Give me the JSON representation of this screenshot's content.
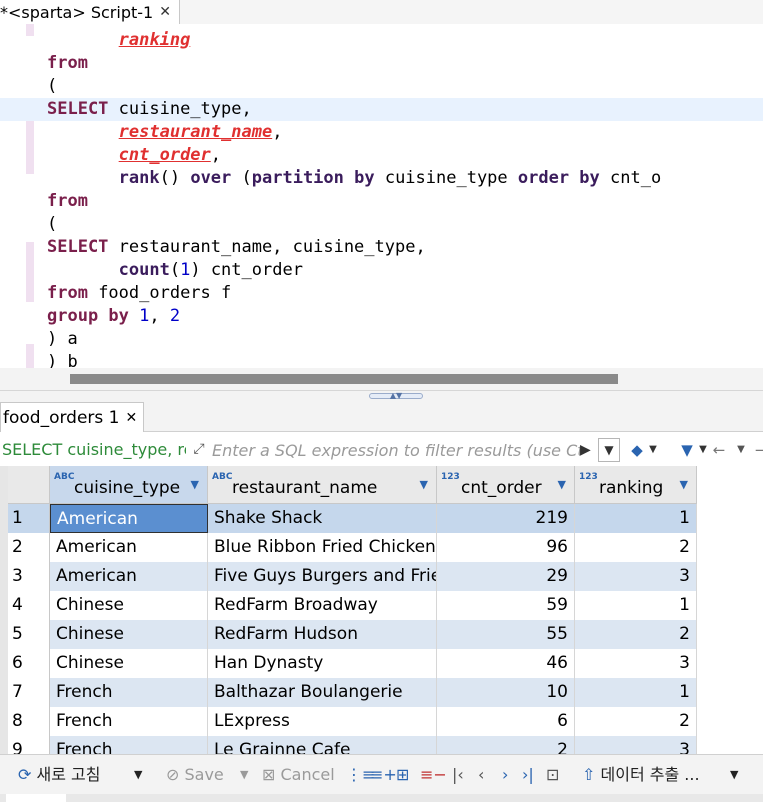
{
  "editor_tab": {
    "title": "*<sparta> Script-1",
    "close": "✕"
  },
  "code_lines": [
    {
      "parts": [
        {
          "t": "       ",
          "c": "plain"
        },
        {
          "t": "ranking",
          "c": "err"
        }
      ]
    },
    {
      "parts": [
        {
          "t": "from",
          "c": "kw"
        }
      ]
    },
    {
      "parts": [
        {
          "t": "(",
          "c": "plain"
        }
      ]
    },
    {
      "parts": [
        {
          "t": "SELECT",
          "c": "kw"
        },
        {
          "t": " cuisine_type,",
          "c": "plain"
        }
      ],
      "current": true
    },
    {
      "parts": [
        {
          "t": "       ",
          "c": "plain"
        },
        {
          "t": "restaurant_name",
          "c": "err"
        },
        {
          "t": ",",
          "c": "plain"
        }
      ]
    },
    {
      "parts": [
        {
          "t": "       ",
          "c": "plain"
        },
        {
          "t": "cnt_order",
          "c": "err"
        },
        {
          "t": ",",
          "c": "plain"
        }
      ]
    },
    {
      "parts": [
        {
          "t": "       ",
          "c": "plain"
        },
        {
          "t": "rank",
          "c": "kw2"
        },
        {
          "t": "() ",
          "c": "plain"
        },
        {
          "t": "over",
          "c": "kw2"
        },
        {
          "t": " (",
          "c": "plain"
        },
        {
          "t": "partition by",
          "c": "kw2"
        },
        {
          "t": " cuisine_type ",
          "c": "plain"
        },
        {
          "t": "order by",
          "c": "kw2"
        },
        {
          "t": " cnt_o",
          "c": "plain"
        }
      ]
    },
    {
      "parts": [
        {
          "t": "from",
          "c": "kw"
        }
      ]
    },
    {
      "parts": [
        {
          "t": "(",
          "c": "plain"
        }
      ]
    },
    {
      "parts": [
        {
          "t": "SELECT",
          "c": "kw"
        },
        {
          "t": " restaurant_name, cuisine_type,",
          "c": "plain"
        }
      ]
    },
    {
      "parts": [
        {
          "t": "       ",
          "c": "plain"
        },
        {
          "t": "count",
          "c": "kw2"
        },
        {
          "t": "(",
          "c": "plain"
        },
        {
          "t": "1",
          "c": "num"
        },
        {
          "t": ") cnt_order",
          "c": "plain"
        }
      ]
    },
    {
      "parts": [
        {
          "t": "from",
          "c": "kw"
        },
        {
          "t": " food_orders f",
          "c": "plain"
        }
      ]
    },
    {
      "parts": [
        {
          "t": "group by",
          "c": "kw"
        },
        {
          "t": " ",
          "c": "plain"
        },
        {
          "t": "1",
          "c": "num"
        },
        {
          "t": ", ",
          "c": "plain"
        },
        {
          "t": "2",
          "c": "num"
        }
      ]
    },
    {
      "parts": [
        {
          "t": ") a",
          "c": "plain"
        }
      ]
    },
    {
      "parts": [
        {
          "t": ") b",
          "c": "plain"
        }
      ]
    }
  ],
  "results_tab": {
    "title": "food_orders 1",
    "close": "✕"
  },
  "filter": {
    "sql_preview": "SELECT cuisine_type, re",
    "placeholder": "Enter a SQL expression to filter results (use Ctrl+Space)"
  },
  "columns": [
    {
      "type": "ABC",
      "label": "cuisine_type"
    },
    {
      "type": "ABC",
      "label": "restaurant_name"
    },
    {
      "type": "123",
      "label": "cnt_order"
    },
    {
      "type": "123",
      "label": "ranking"
    }
  ],
  "rows": [
    {
      "n": "1",
      "cuisine_type": "American",
      "restaurant_name": "Shake Shack",
      "cnt_order": "219",
      "ranking": "1"
    },
    {
      "n": "2",
      "cuisine_type": "American",
      "restaurant_name": "Blue Ribbon Fried Chicken",
      "cnt_order": "96",
      "ranking": "2"
    },
    {
      "n": "3",
      "cuisine_type": "American",
      "restaurant_name": "Five Guys Burgers and Fries",
      "cnt_order": "29",
      "ranking": "3"
    },
    {
      "n": "4",
      "cuisine_type": "Chinese",
      "restaurant_name": "RedFarm Broadway",
      "cnt_order": "59",
      "ranking": "1"
    },
    {
      "n": "5",
      "cuisine_type": "Chinese",
      "restaurant_name": "RedFarm Hudson",
      "cnt_order": "55",
      "ranking": "2"
    },
    {
      "n": "6",
      "cuisine_type": "Chinese",
      "restaurant_name": "Han Dynasty",
      "cnt_order": "46",
      "ranking": "3"
    },
    {
      "n": "7",
      "cuisine_type": "French",
      "restaurant_name": "Balthazar Boulangerie",
      "cnt_order": "10",
      "ranking": "1"
    },
    {
      "n": "8",
      "cuisine_type": "French",
      "restaurant_name": "LExpress",
      "cnt_order": "6",
      "ranking": "2"
    },
    {
      "n": "9",
      "cuisine_type": "French",
      "restaurant_name": "Le Grainne Cafe",
      "cnt_order": "2",
      "ranking": "3"
    }
  ],
  "toolbar": {
    "refresh": "새로 고침",
    "save": "Save",
    "cancel": "Cancel",
    "export": "데이터 추출 ..."
  },
  "colors": {
    "accent": "#2a64b0",
    "selected_cell": "#5b8fd0",
    "row_alt": "#dce6f2",
    "keyword": "#7a1f4b",
    "error": "#e03030"
  }
}
